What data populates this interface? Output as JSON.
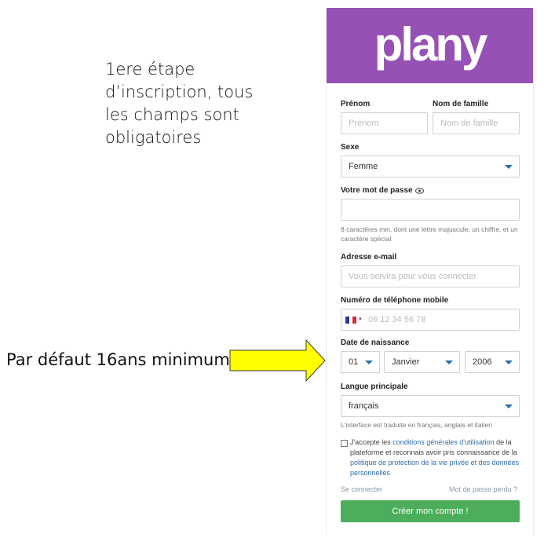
{
  "annotations": {
    "top_note": "1ere étape d’inscription, tous les champs sont obligatoires",
    "left_note": "Par défaut 16ans minimum"
  },
  "brand": {
    "logo": "plany",
    "color": "#9651b5"
  },
  "form": {
    "first_name": {
      "label": "Prénom",
      "placeholder": "Prénom"
    },
    "last_name": {
      "label": "Nom de famille",
      "placeholder": "Nom de famille"
    },
    "gender": {
      "label": "Sexe",
      "value": "Femme"
    },
    "password": {
      "label": "Votre mot de passe",
      "hint": "8 caractères min. dont une lettre majuscule, un chiffre, et un caractère spécial"
    },
    "email": {
      "label": "Adresse e-mail",
      "placeholder": "Vous servira pour vous connecter"
    },
    "phone": {
      "label": "Numéro de téléphone mobile",
      "placeholder": "06 12 34 56 78"
    },
    "birthdate": {
      "label": "Date de naissance",
      "day": "01",
      "month": "Janvier",
      "year": "2006"
    },
    "language": {
      "label": "Langue principale",
      "value": "français",
      "hint": "L'interface est traduite en français, anglais et italien"
    },
    "consent": {
      "text_1": "J'accepte les ",
      "link_terms": "conditions générales d'utilisation",
      "text_2": " de la plateforme et reconnais avoir pris connaissance de la ",
      "link_privacy": "politique de protection de la vie privée et des données personnelles"
    },
    "login_link": "Se connecter",
    "forgot_link": "Mot de passe perdu ?",
    "submit": "Créer mon compte !"
  },
  "colors": {
    "accent_blue": "#2a6fa8",
    "cta_green": "#4cae5b",
    "arrow_yellow": "#ffff00"
  }
}
